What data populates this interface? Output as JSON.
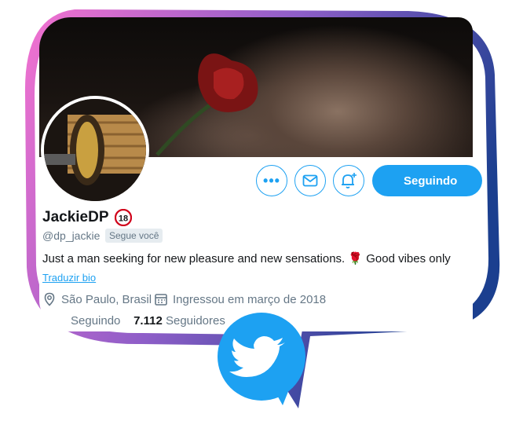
{
  "profile": {
    "name": "JackieDP",
    "adult_badge": "18",
    "handle": "@dp_jackie",
    "follows_you": "Segue você",
    "bio": "Just a man seeking for new pleasure and new sensations. 🌹 Good vibes only",
    "translate_bio": "Traduzir bio",
    "location": "São Paulo, Brasil",
    "joined": "Ingressou em março de 2018",
    "following_label": "Seguindo",
    "followers_count": "7.112",
    "followers_label": "Seguidores"
  },
  "actions": {
    "more_icon": "more-icon",
    "message_icon": "mail-icon",
    "notify_icon": "bell-plus-icon",
    "follow_button_label": "Seguindo"
  },
  "colors": {
    "accent": "#1da1f2",
    "frame_left": "#f06fd0",
    "frame_right": "#1b3f8f"
  }
}
